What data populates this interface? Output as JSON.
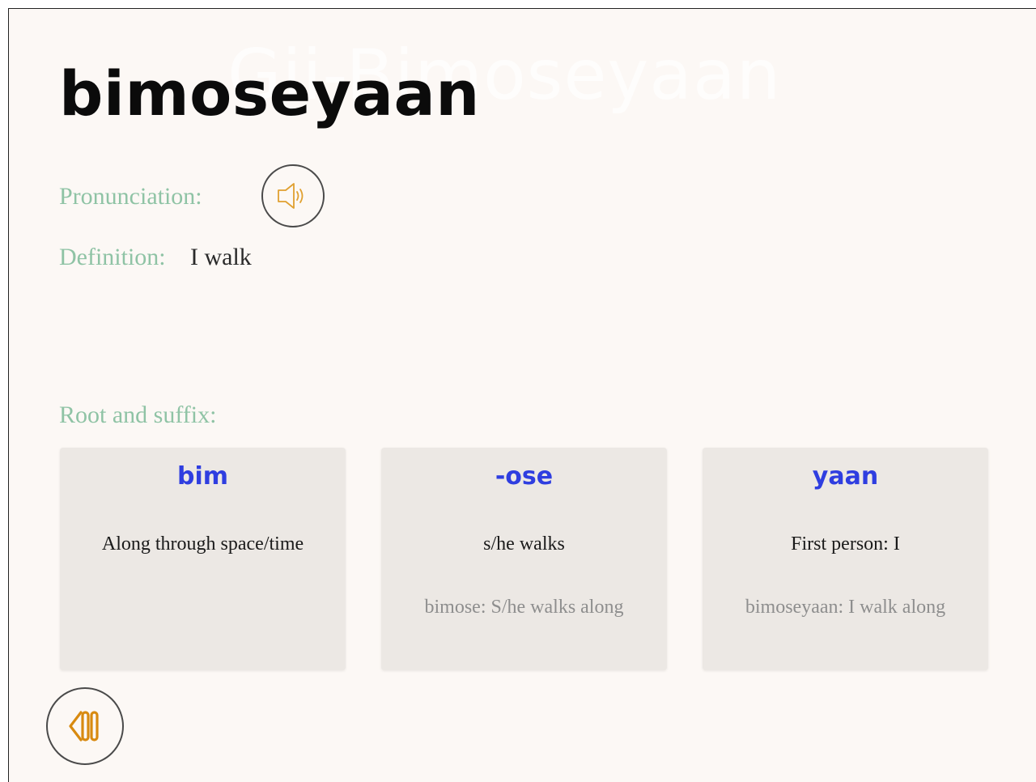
{
  "header": {
    "ghost_title": "Gii-Bimoseyaan",
    "word": "bimoseyaan"
  },
  "pronunciation": {
    "label": "Pronunciation:",
    "icon": "speaker-icon"
  },
  "definition": {
    "label": "Definition:",
    "value": "I walk"
  },
  "morphology": {
    "label": "Root and suffix:",
    "cards": [
      {
        "title": "bim",
        "meaning": "Along through space/time",
        "example": ""
      },
      {
        "title": "-ose",
        "meaning": "s/he walks",
        "example": "bimose:  S/he walks along"
      },
      {
        "title": "yaan",
        "meaning": "First person:  I",
        "example": "bimoseyaan: I walk along"
      }
    ]
  },
  "navigation": {
    "back_icon": "rewind-icon"
  },
  "colors": {
    "background": "#fcf8f5",
    "label": "#8fc3a5",
    "card_title": "#2f3ee0",
    "icon_accent": "#e0a030",
    "card_bg": "#ece8e4"
  }
}
